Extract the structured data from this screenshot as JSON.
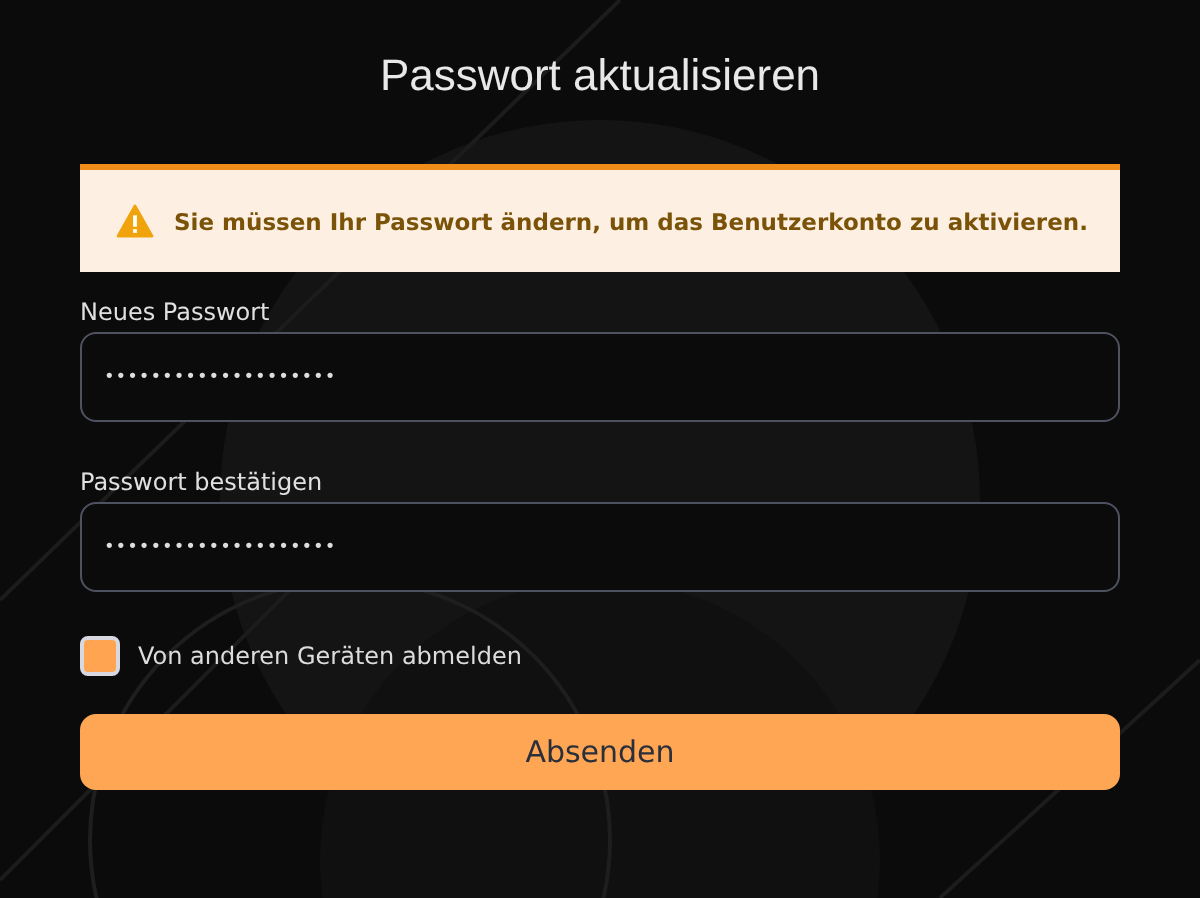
{
  "title": "Passwort aktualisieren",
  "alert": {
    "kind": "warning",
    "text": "Sie müssen Ihr Passwort ändern, um das Benutzerkonto zu aktivieren."
  },
  "fields": [
    {
      "label": "Neues Passwort",
      "value": "••••••••••••••••••••"
    },
    {
      "label": "Passwort bestätigen",
      "value": "••••••••••••••••••••"
    }
  ],
  "checkbox": {
    "label": "Von anderen Geräten abmelden",
    "checked": true
  },
  "submit": "Absenden"
}
